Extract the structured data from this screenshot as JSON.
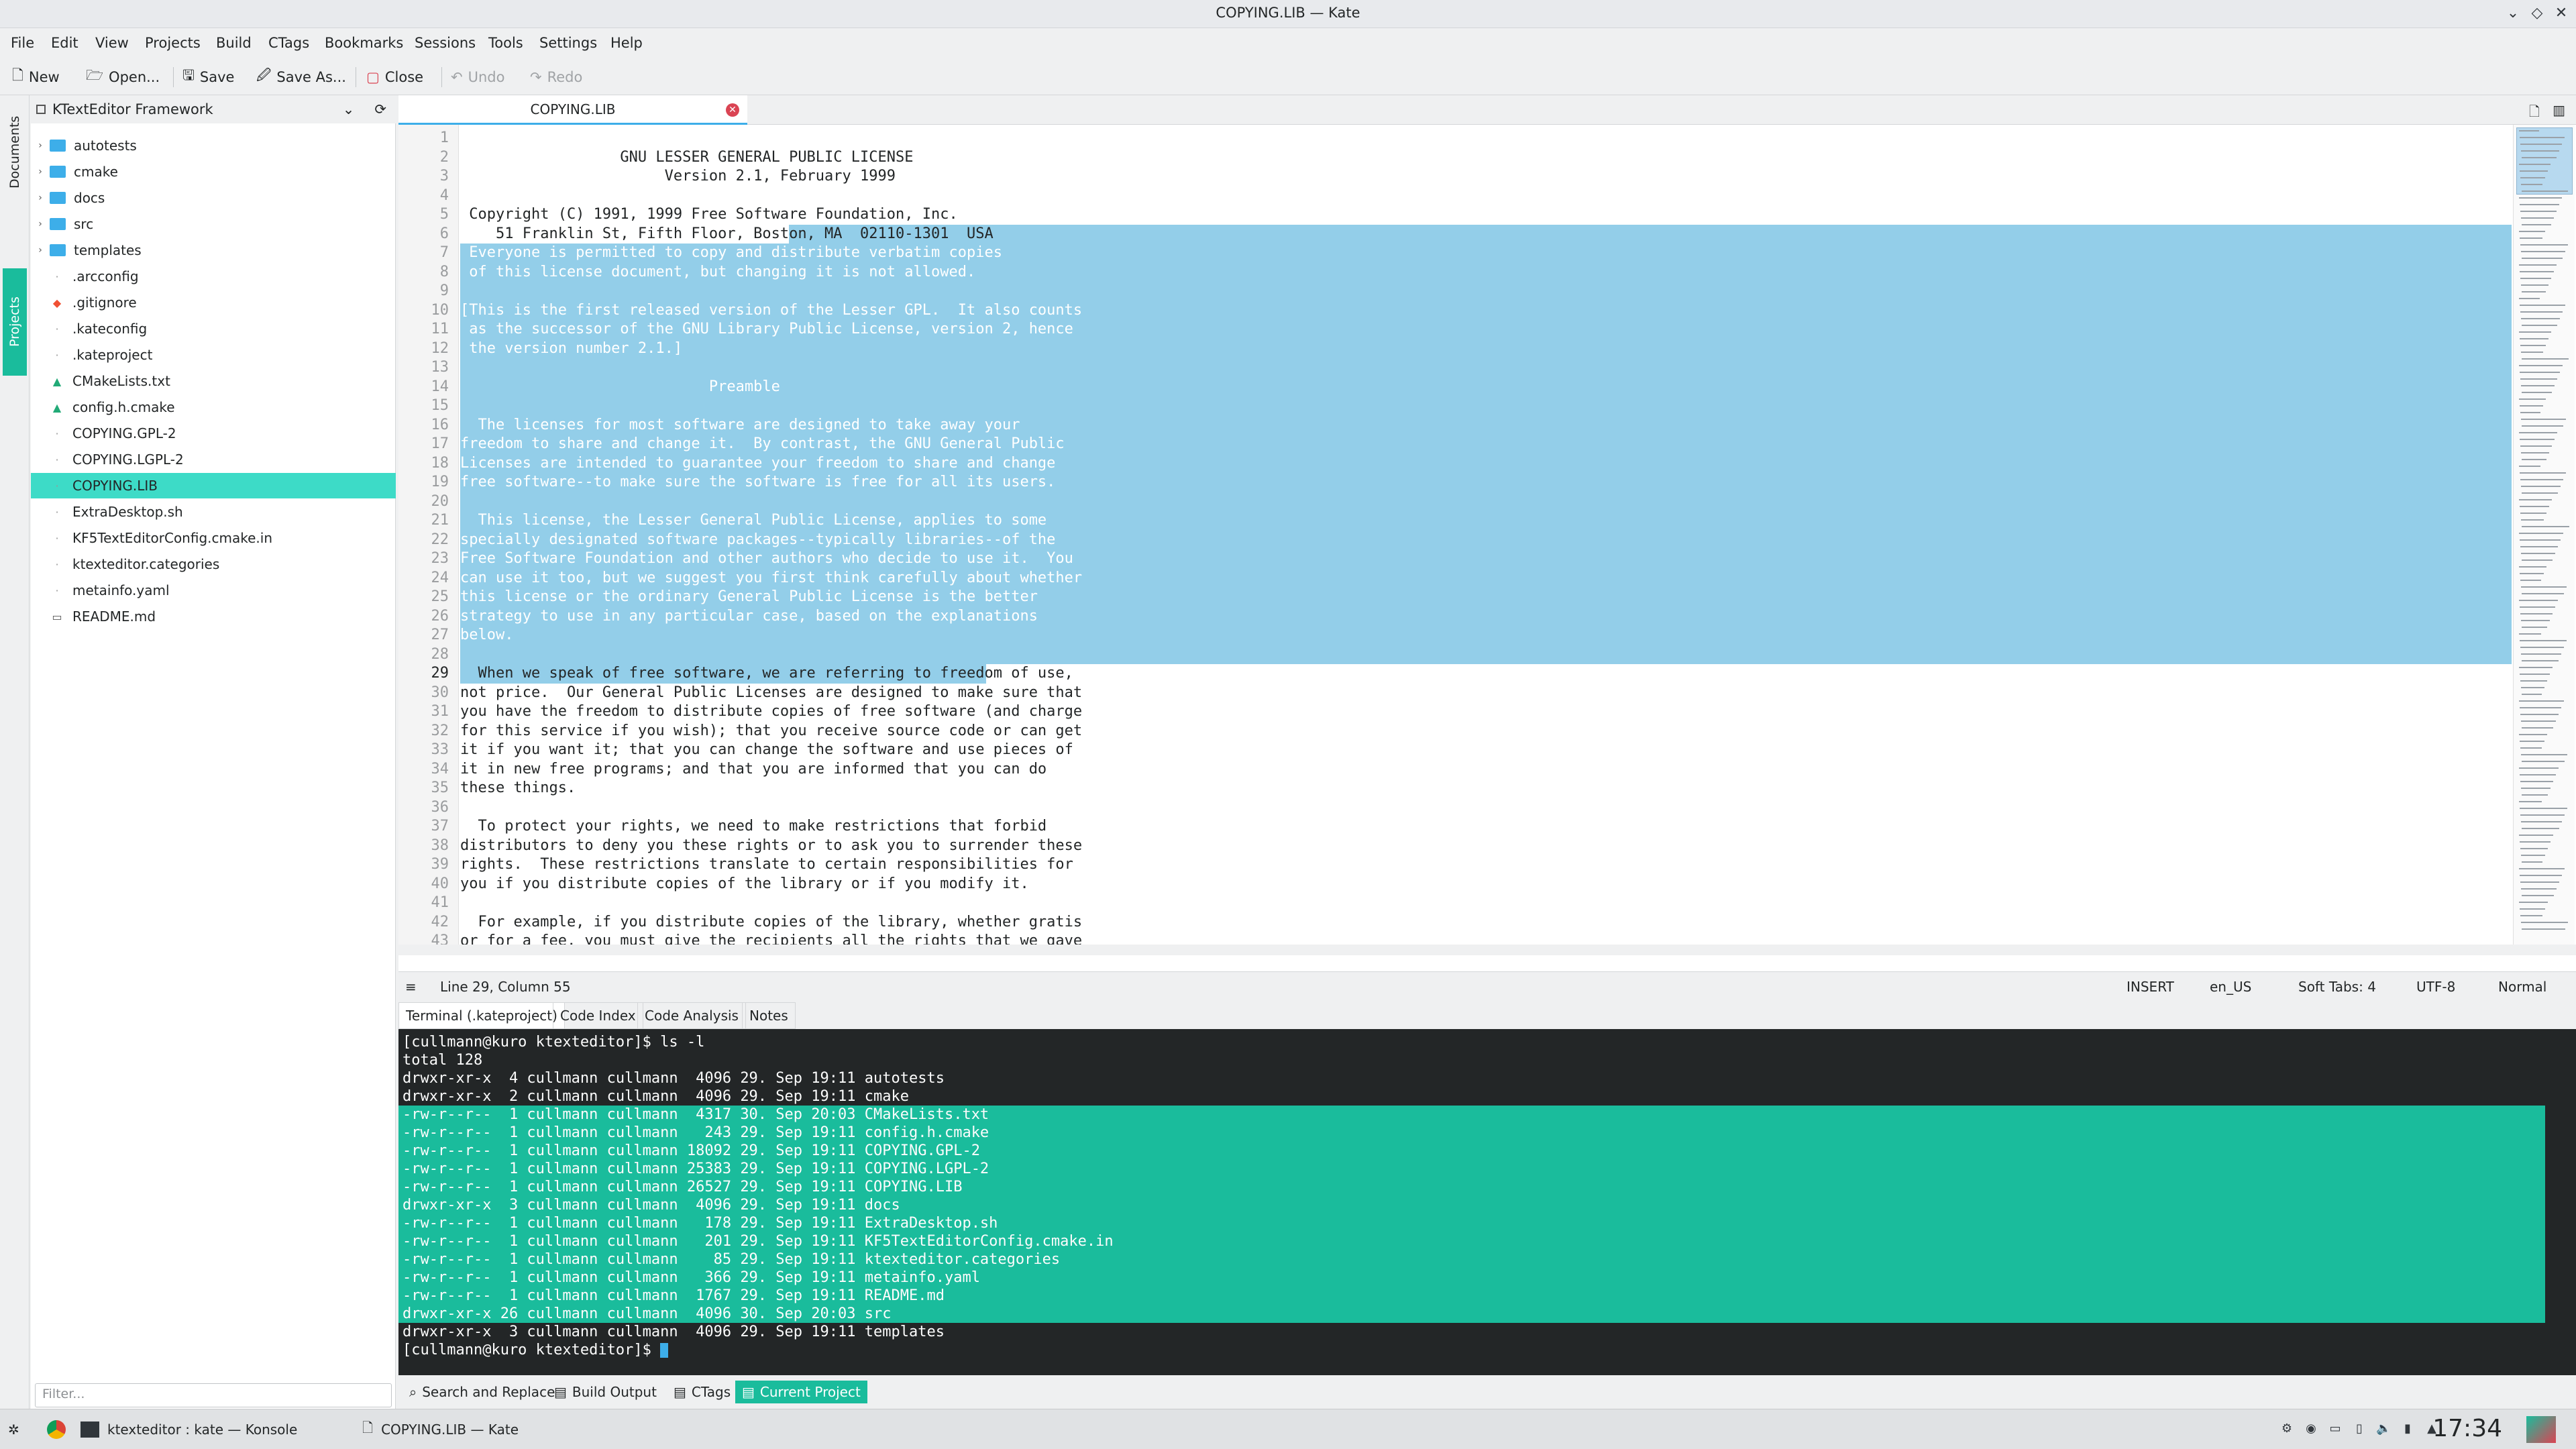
{
  "window": {
    "title": "COPYING.LIB — Kate"
  },
  "menu": [
    "File",
    "Edit",
    "View",
    "Projects",
    "Build",
    "CTags",
    "Bookmarks",
    "Sessions",
    "Tools",
    "Settings",
    "Help"
  ],
  "toolbar": {
    "new": "New",
    "open": "Open...",
    "save": "Save",
    "save_as": "Save As...",
    "close": "Close",
    "undo": "Undo",
    "redo": "Redo"
  },
  "sidetabs": {
    "documents": "Documents",
    "projects": "Projects"
  },
  "project": {
    "name": "KTextEditor Framework",
    "items": [
      {
        "label": "autotests",
        "type": "folder"
      },
      {
        "label": "cmake",
        "type": "folder"
      },
      {
        "label": "docs",
        "type": "folder"
      },
      {
        "label": "src",
        "type": "folder"
      },
      {
        "label": "templates",
        "type": "folder"
      },
      {
        "label": ".arcconfig",
        "type": "file"
      },
      {
        "label": ".gitignore",
        "type": "git"
      },
      {
        "label": ".kateconfig",
        "type": "file"
      },
      {
        "label": ".kateproject",
        "type": "file"
      },
      {
        "label": "CMakeLists.txt",
        "type": "cmake"
      },
      {
        "label": "config.h.cmake",
        "type": "cmake"
      },
      {
        "label": "COPYING.GPL-2",
        "type": "file"
      },
      {
        "label": "COPYING.LGPL-2",
        "type": "file"
      },
      {
        "label": "COPYING.LIB",
        "type": "file",
        "selected": true
      },
      {
        "label": "ExtraDesktop.sh",
        "type": "file"
      },
      {
        "label": "KF5TextEditorConfig.cmake.in",
        "type": "file"
      },
      {
        "label": "ktexteditor.categories",
        "type": "file"
      },
      {
        "label": "metainfo.yaml",
        "type": "file"
      },
      {
        "label": "README.md",
        "type": "md"
      }
    ],
    "filter_placeholder": "Filter..."
  },
  "editor": {
    "tab": "COPYING.LIB",
    "lines": [
      "",
      "                  GNU LESSER GENERAL PUBLIC LICENSE",
      "                       Version 2.1, February 1999",
      "",
      " Copyright (C) 1991, 1999 Free Software Foundation, Inc.",
      "    51 Franklin St, Fifth Floor, Boston, MA  02110-1301  USA",
      " Everyone is permitted to copy and distribute verbatim copies",
      " of this license document, but changing it is not allowed.",
      "",
      "[This is the first released version of the Lesser GPL.  It also counts",
      " as the successor of the GNU Library Public License, version 2, hence",
      " the version number 2.1.]",
      "",
      "                            Preamble",
      "",
      "  The licenses for most software are designed to take away your",
      "freedom to share and change it.  By contrast, the GNU General Public",
      "Licenses are intended to guarantee your freedom to share and change",
      "free software--to make sure the software is free for all its users.",
      "",
      "  This license, the Lesser General Public License, applies to some",
      "specially designated software packages--typically libraries--of the",
      "Free Software Foundation and other authors who decide to use it.  You",
      "can use it too, but we suggest you first think carefully about whether",
      "this license or the ordinary General Public License is the better",
      "strategy to use in any particular case, based on the explanations",
      "below.",
      "",
      "  When we speak of free software, we are referring to freedom of use,",
      "not price.  Our General Public Licenses are designed to make sure that",
      "you have the freedom to distribute copies of free software (and charge",
      "for this service if you wish); that you receive source code or can get",
      "it if you want it; that you can change the software and use pieces of",
      "it in new free programs; and that you are informed that you can do",
      "these things.",
      "",
      "  To protect your rights, we need to make restrictions that forbid",
      "distributors to deny you these rights or to ask you to surrender these",
      "rights.  These restrictions translate to certain responsibilities for",
      "you if you distribute copies of the library or if you modify it.",
      "",
      "  For example, if you distribute copies of the library, whether gratis",
      "or for a fee, you must give the recipients all the rights that we gave"
    ],
    "current_line": 29
  },
  "status": {
    "position": "Line 29, Column 55",
    "mode": "INSERT",
    "language": "en_US",
    "indent": "Soft Tabs: 4",
    "encoding": "UTF-8",
    "input": "Normal"
  },
  "bottom_tabs": [
    "Terminal (.kateproject)",
    "Code Index",
    "Code Analysis",
    "Notes"
  ],
  "terminal": {
    "lines": [
      "[cullmann@kuro ktexteditor]$ ls -l",
      "total 128",
      "drwxr-xr-x  4 cullmann cullmann  4096 29. Sep 19:11 autotests",
      "drwxr-xr-x  2 cullmann cullmann  4096 29. Sep 19:11 cmake",
      "-rw-r--r--  1 cullmann cullmann  4317 30. Sep 20:03 CMakeLists.txt",
      "-rw-r--r--  1 cullmann cullmann   243 29. Sep 19:11 config.h.cmake",
      "-rw-r--r--  1 cullmann cullmann 18092 29. Sep 19:11 COPYING.GPL-2",
      "-rw-r--r--  1 cullmann cullmann 25383 29. Sep 19:11 COPYING.LGPL-2",
      "-rw-r--r--  1 cullmann cullmann 26527 29. Sep 19:11 COPYING.LIB",
      "drwxr-xr-x  3 cullmann cullmann  4096 29. Sep 19:11 docs",
      "-rw-r--r--  1 cullmann cullmann   178 29. Sep 19:11 ExtraDesktop.sh",
      "-rw-r--r--  1 cullmann cullmann   201 29. Sep 19:11 KF5TextEditorConfig.cmake.in",
      "-rw-r--r--  1 cullmann cullmann    85 29. Sep 19:11 ktexteditor.categories",
      "-rw-r--r--  1 cullmann cullmann   366 29. Sep 19:11 metainfo.yaml",
      "-rw-r--r--  1 cullmann cullmann  1767 29. Sep 19:11 README.md",
      "drwxr-xr-x 26 cullmann cullmann  4096 30. Sep 20:03 src",
      "drwxr-xr-x  3 cullmann cullmann  4096 29. Sep 19:11 templates",
      "[cullmann@kuro ktexteditor]$ "
    ]
  },
  "toolviews": [
    "Search and Replace",
    "Build Output",
    "CTags",
    "Current Project"
  ],
  "taskbar": {
    "tasks": [
      "ktexteditor : kate — Konsole",
      "COPYING.LIB — Kate"
    ],
    "clock": "17:34"
  },
  "colors": {
    "accent": "#3daee9",
    "selection": "#93cee9",
    "teal": "#1abc9c",
    "close": "#da4453"
  }
}
